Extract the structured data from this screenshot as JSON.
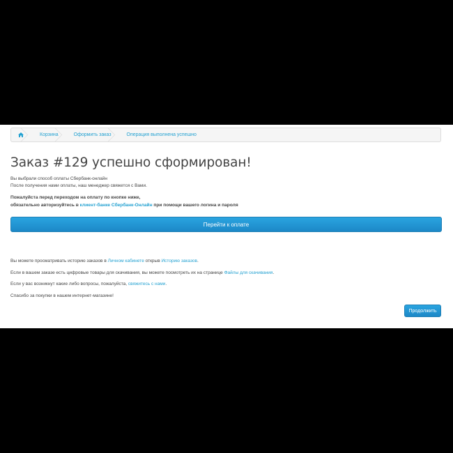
{
  "breadcrumb": {
    "items": [
      {
        "label": "Корзина"
      },
      {
        "label": "Оформить заказ"
      },
      {
        "label": "Операция выполнена успешно"
      }
    ]
  },
  "title": "Заказ #129 успешно сформирован!",
  "info": {
    "line1": "Вы выбрали способ оплаты Сбербанк-онлайн",
    "line2": "После получения нами оплаты, наш менеджер свяжется с Вами."
  },
  "notice": {
    "line1": "Пожалуйста перед переходом на оплату по кнопке ниже,",
    "line2_prefix": "обязательно авторизуйтесь в ",
    "line2_link": "клиент-банке Сбербанк-Онлайн",
    "line2_suffix": " при помощи вашего логина и пароля"
  },
  "pay_button": "Перейти к оплате",
  "paragraphs": {
    "history_prefix": "Вы можете просматривать историю заказов в ",
    "history_link1": "Личном кабинете",
    "history_mid": " открыв ",
    "history_link2": "Историю заказов",
    "history_suffix": ".",
    "downloads_prefix": "Если в вашем заказе есть цифровые товары для скачивания, вы можете посмотреть их на странице ",
    "downloads_link": "Файлы для скачивания",
    "downloads_suffix": ".",
    "contact_prefix": "Если у вас возникнут какие либо вопросы, пожалуйста, ",
    "contact_link": "свяжитесь с нами",
    "contact_suffix": ".",
    "thanks": "Спасибо за покупки в нашем интернет-магазине!"
  },
  "continue_button": "Продолжить",
  "colors": {
    "accent": "#23a1d1",
    "button": "#1c88c7"
  }
}
